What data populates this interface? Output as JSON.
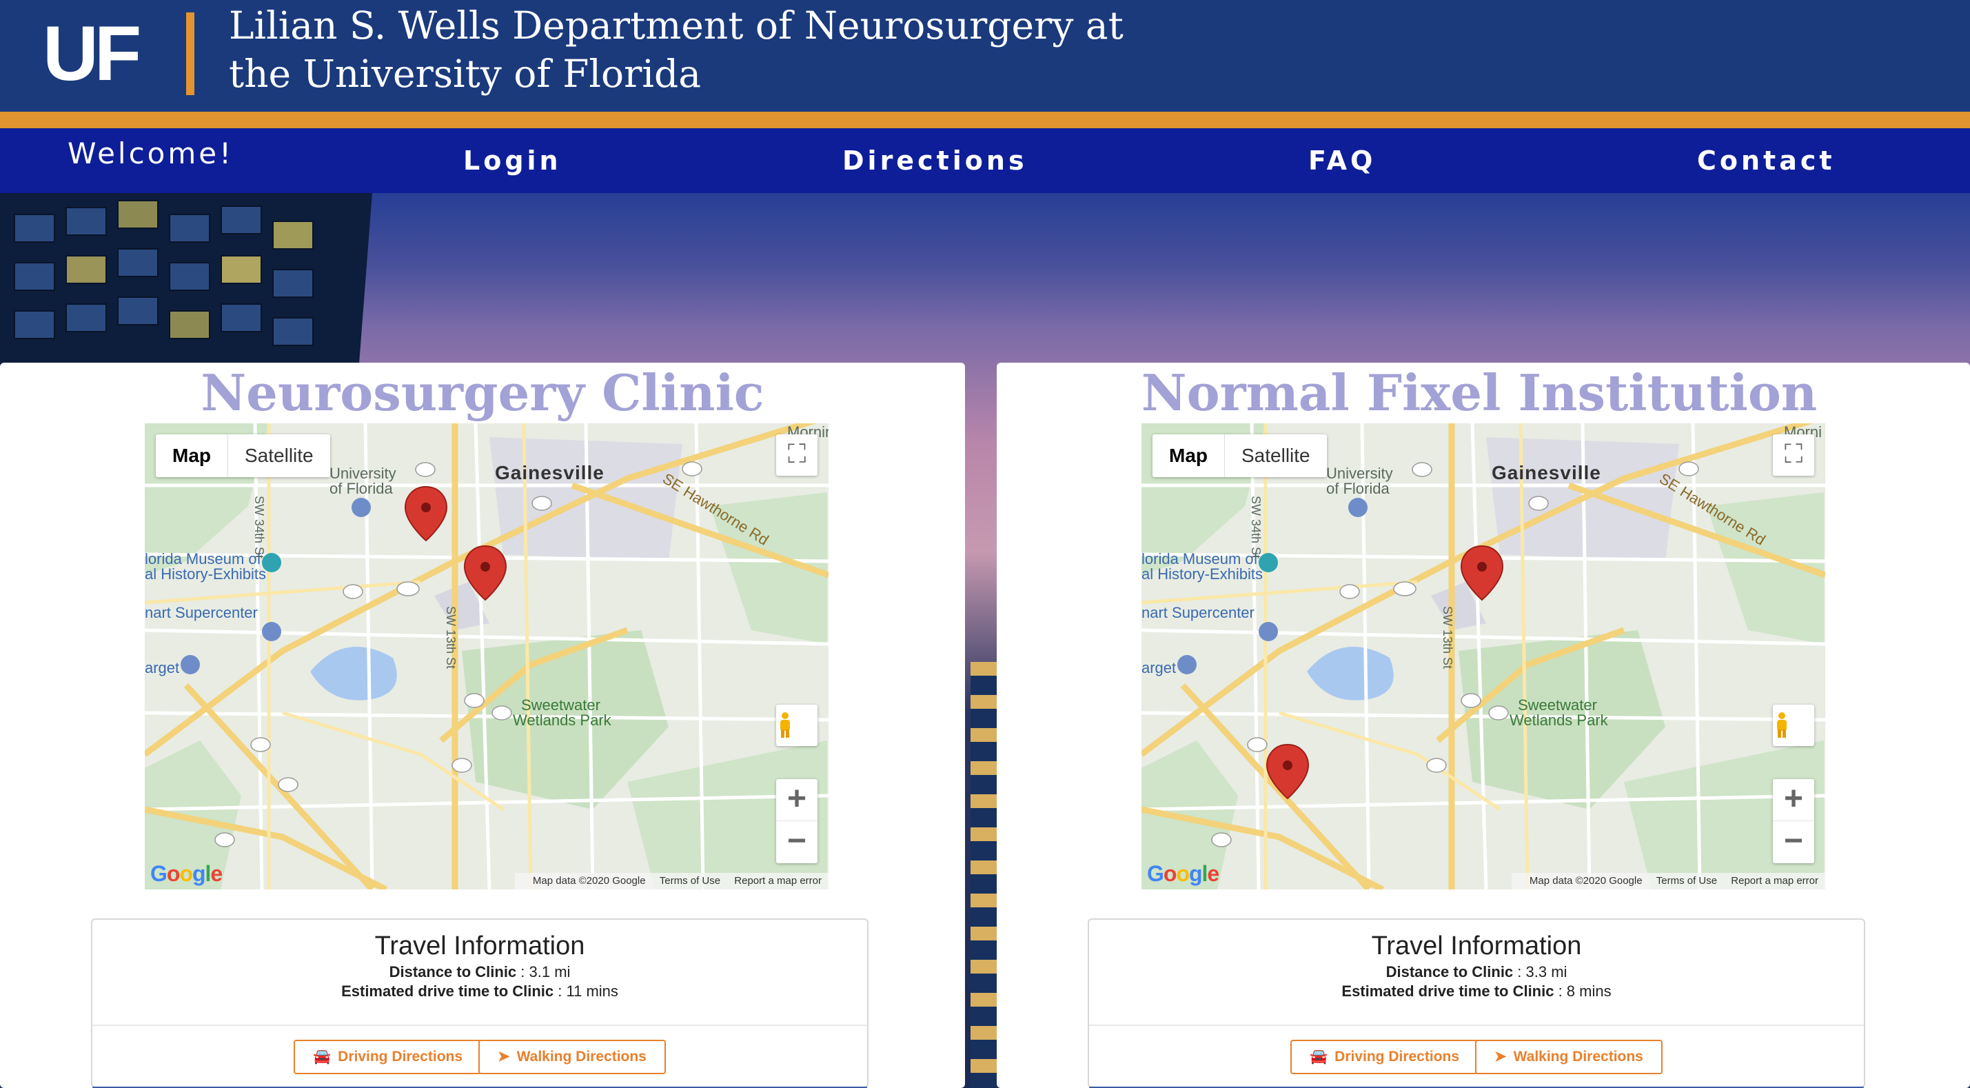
{
  "header": {
    "logo_text": "UF",
    "title_line1": "Lilian S. Wells Department of Neurosurgery at",
    "title_line2": "the University of Florida"
  },
  "nav": {
    "welcome": "Welcome!",
    "items": [
      {
        "label": "Login"
      },
      {
        "label": "Directions"
      },
      {
        "label": "FAQ"
      },
      {
        "label": "Contact"
      }
    ]
  },
  "panels": [
    {
      "title": "Neurosurgery Clinic",
      "map": {
        "type_map": "Map",
        "type_satellite": "Satellite",
        "google": "Google",
        "attribution": "Map data ©2020 Google",
        "terms": "Terms of Use",
        "report": "Report a map error",
        "labels": {
          "city": "Gainesville",
          "uf": "University",
          "uf2": "of Florida",
          "museum": "lorida Museum of",
          "museum2": "al History-Exhibits",
          "supercenter": "nart Supercenter",
          "target": "arget",
          "park": "Sweetwater",
          "park2": "Wetlands Park",
          "morning": "Mornin",
          "hawthorne": "SE Hawthorne Rd",
          "sw34": "SW 34th St",
          "sw13": "SW 13th St"
        }
      },
      "travel": {
        "title": "Travel Information",
        "distance_label": "Distance to Clinic",
        "distance_value": " : 3.1 mi",
        "time_label": "Estimated drive time to Clinic",
        "time_value": " : 11 mins",
        "driving": "Driving Directions",
        "walking": "Walking Directions"
      }
    },
    {
      "title": "Normal Fixel Institution",
      "map": {
        "type_map": "Map",
        "type_satellite": "Satellite",
        "google": "Google",
        "attribution": "Map data ©2020 Google",
        "terms": "Terms of Use",
        "report": "Report a map error",
        "labels": {
          "city": "Gainesville",
          "uf": "University",
          "uf2": "of Florida",
          "museum": "lorida Museum of",
          "museum2": "al History-Exhibits",
          "supercenter": "nart Supercenter",
          "target": "arget",
          "park": "Sweetwater",
          "park2": "Wetlands Park",
          "morning": "Morni",
          "hawthorne": "SE Hawthorne Rd",
          "sw34": "SW 34th St",
          "sw13": "SW 13th St"
        }
      },
      "travel": {
        "title": "Travel Information",
        "distance_label": "Distance to Clinic",
        "distance_value": " : 3.3 mi",
        "time_label": "Estimated drive time to Clinic",
        "time_value": " : 8 mins",
        "driving": "Driving Directions",
        "walking": "Walking Directions"
      }
    }
  ],
  "colors": {
    "header_bg": "#1a3a7c",
    "accent_orange": "#e19430",
    "nav_bg": "#0e1e98",
    "title_lavender": "#a3a2d6",
    "button_orange": "#e9802c",
    "marker_red": "#d6382f"
  },
  "icons": [
    "fullscreen-icon",
    "pegman-icon",
    "zoom-in-icon",
    "zoom-out-icon",
    "map-marker-icon",
    "car-icon",
    "navigation-arrow-icon"
  ]
}
